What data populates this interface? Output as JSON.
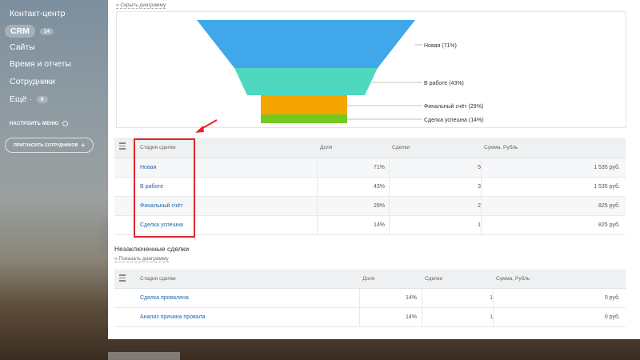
{
  "sidebar": {
    "items": [
      {
        "label": "Контакт-центр"
      },
      {
        "label": "CRM",
        "count": "14"
      },
      {
        "label": "Сайты"
      },
      {
        "label": "Время и отчеты"
      },
      {
        "label": "Сотрудники"
      },
      {
        "label": "Ещё ·",
        "count": "6"
      }
    ],
    "settings_label": "НАСТРОИТЬ МЕНЮ",
    "invite_label": "ПРИГЛАСИТЬ СОТРУДНИКОВ"
  },
  "main": {
    "hide_diagram_link": "« Скрыть диаграмму",
    "show_diagram_link": "« Показать диаграмму",
    "unfinished_title": "Незаключенные сделки"
  },
  "funnel": {
    "segments": [
      {
        "label": "Новая (71%)",
        "share": 71,
        "color": "#3fa7ea"
      },
      {
        "label": "В работе (43%)",
        "share": 43,
        "color": "#4fd8c0"
      },
      {
        "label": "Финальный счёт (29%)",
        "share": 29,
        "color": "#f5a500"
      },
      {
        "label": "Сделка успешна (14%)",
        "share": 14,
        "color": "#75c81e"
      }
    ]
  },
  "table1": {
    "headers": [
      "Стадия сделки",
      "Доля",
      "Сделки",
      "Сумма, Рубль"
    ],
    "rows": [
      [
        "Новая",
        "71%",
        "5",
        "1 535 руб."
      ],
      [
        "В работе",
        "43%",
        "3",
        "1 535 руб."
      ],
      [
        "Финальный счёт",
        "29%",
        "2",
        "825 руб."
      ],
      [
        "Сделка успешна",
        "14%",
        "1",
        "825 руб."
      ]
    ]
  },
  "table2": {
    "headers": [
      "Стадия сделки",
      "Доля",
      "Сделки",
      "Сумма, Рубль"
    ],
    "rows": [
      [
        "Сделка провалена",
        "14%",
        "1",
        "0 руб."
      ],
      [
        "Анализ причина провала",
        "14%",
        "1",
        "0 руб."
      ]
    ]
  },
  "colors": {
    "highlight": "#e0262b",
    "link": "#2067b0"
  }
}
